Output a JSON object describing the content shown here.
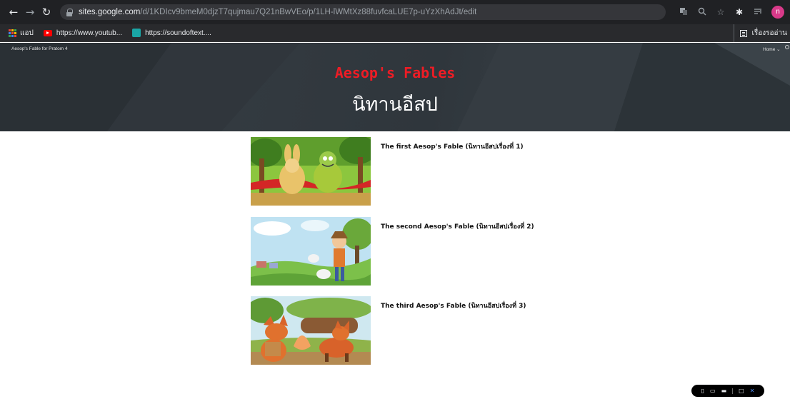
{
  "browser": {
    "url_host": "sites.google.com",
    "url_path": "/d/1KDIcv9bmeM0djzT7qujmau7Q21nBwVEo/p/1LH-lWMtXz88fuvfcaLUE7p-uYzXhAdJt/edit",
    "avatar_initial": "n",
    "icons": [
      "back-icon",
      "forward-icon",
      "reload-icon",
      "lock-icon",
      "translate-icon",
      "zoom-icon",
      "star-icon",
      "extensions-icon",
      "media-icon",
      "menu-icon"
    ],
    "bookmarks": [
      {
        "label": "แอป",
        "icon": "apps-icon"
      },
      {
        "label": "https://www.youtub...",
        "icon": "youtube-icon"
      },
      {
        "label": "https://soundoftext....",
        "icon": "soundoftext-icon"
      }
    ],
    "reading_list_label": "เรื่องรออ่าน"
  },
  "site": {
    "name": "Aesop's Fable for Pratom 4",
    "nav_home": "Home",
    "title": "Aesop's Fables",
    "subtitle": "นิทานอีสป",
    "title_color": "#ee1c25"
  },
  "fables": [
    {
      "title": "The first Aesop's Fable (นิทานอีสปเรื่องที่ 1)",
      "image": "tortoise-and-hare-illustration"
    },
    {
      "title": "The second Aesop's Fable (นิทานอีสปเรื่องที่ 2)",
      "image": "shepherd-boy-illustration"
    },
    {
      "title": "The third Aesop's Fable (นิทานอีสปเรื่องที่ 3)",
      "image": "two-foxes-illustration"
    }
  ],
  "mini_toolbar": {
    "icons": [
      "phone-preview-icon",
      "tablet-preview-icon",
      "desktop-preview-icon",
      "comment-icon",
      "close-icon"
    ]
  }
}
